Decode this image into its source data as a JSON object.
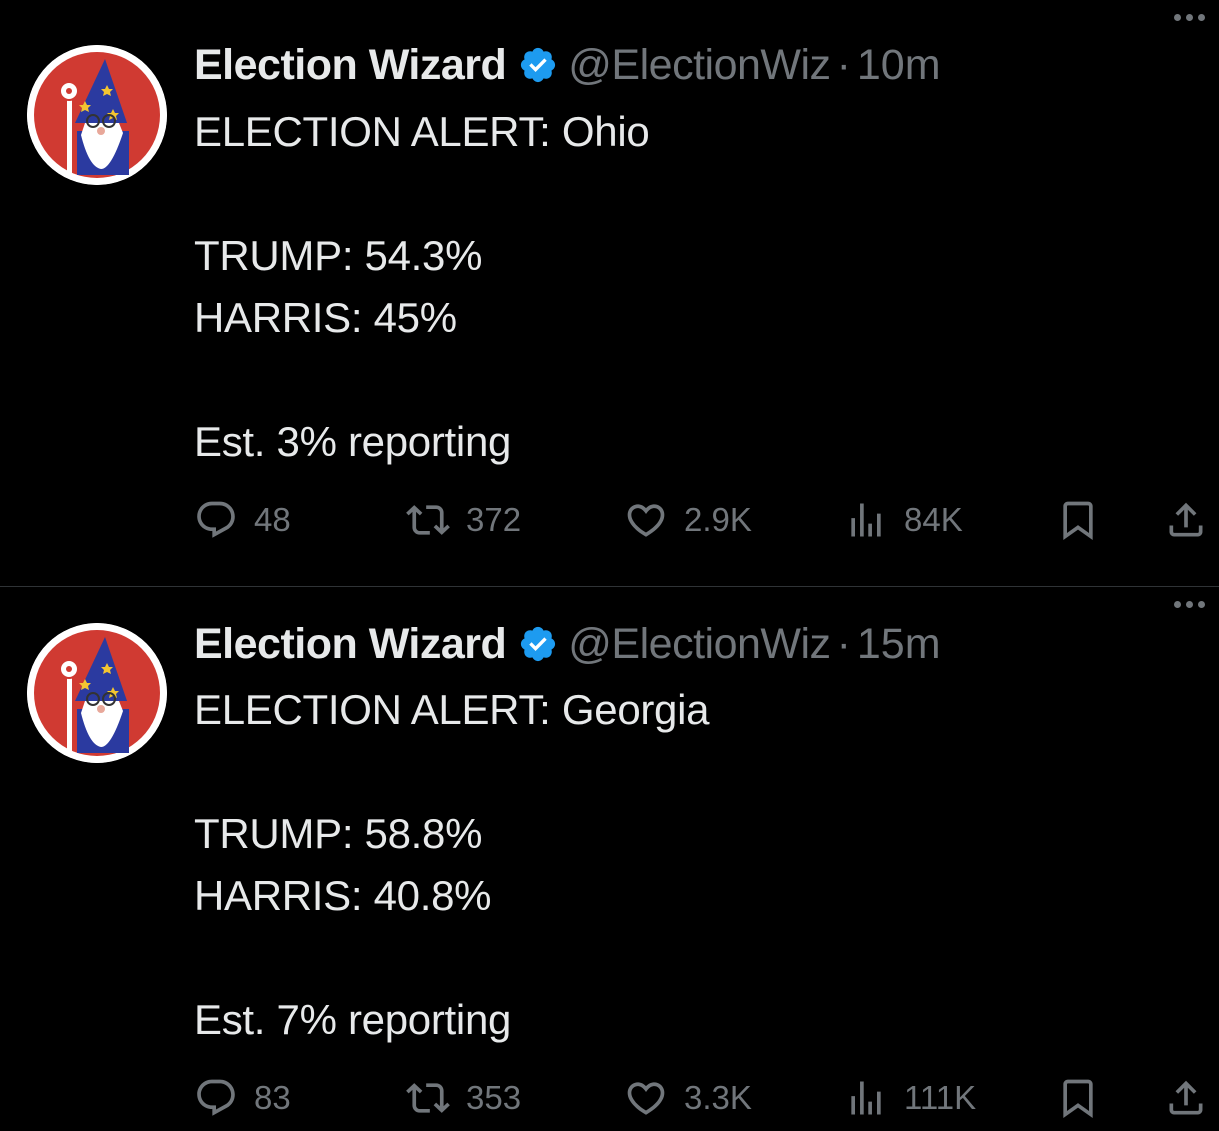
{
  "tweets": [
    {
      "author": {
        "name": "Election Wizard",
        "handle": "@ElectionWiz",
        "verified_icon": "verified-badge-icon"
      },
      "separator": "·",
      "time": "10m",
      "lines": [
        "ELECTION ALERT: Ohio",
        "",
        "TRUMP: 54.3%",
        "HARRIS: 45%",
        "",
        "Est. 3% reporting"
      ],
      "stats": {
        "replies": "48",
        "reposts": "372",
        "likes": "2.9K",
        "views": "84K"
      }
    },
    {
      "author": {
        "name": "Election Wizard",
        "handle": "@ElectionWiz",
        "verified_icon": "verified-badge-icon"
      },
      "separator": "·",
      "time": "15m",
      "lines": [
        "ELECTION ALERT: Georgia",
        "",
        "TRUMP: 58.8%",
        "HARRIS: 40.8%",
        "",
        "Est. 7% reporting"
      ],
      "stats": {
        "replies": "83",
        "reposts": "353",
        "likes": "3.3K",
        "views": "111K"
      }
    }
  ],
  "colors": {
    "background": "#000000",
    "text_primary": "#e7e9ea",
    "text_secondary": "#71767b",
    "verified_blue": "#1d9bf0",
    "divider": "#2f3336",
    "avatar_red": "#d03a32"
  },
  "icons": [
    "reply-icon",
    "repost-icon",
    "like-icon",
    "views-icon",
    "bookmark-icon",
    "share-icon",
    "more-icon"
  ]
}
